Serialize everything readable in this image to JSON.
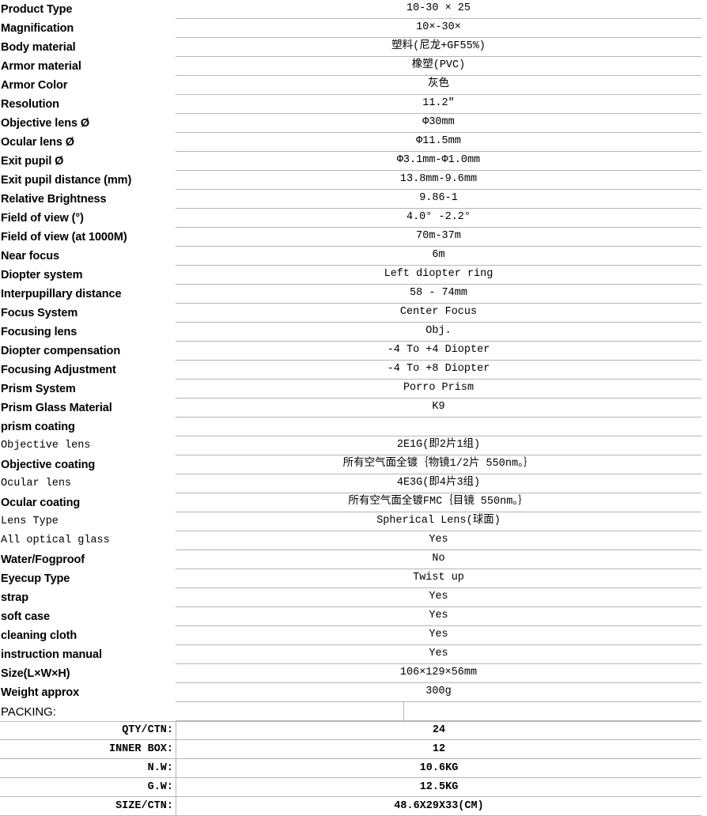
{
  "table": {
    "rows": [
      {
        "label": "Product Type",
        "label_style": "sans",
        "value": "10-30 × 25"
      },
      {
        "label": "Magnification",
        "label_style": "sans",
        "value": "10×-30×"
      },
      {
        "label": "Body  material",
        "label_style": "sans",
        "value": "塑料(尼龙+GF55%)"
      },
      {
        "label": "Armor material",
        "label_style": "sans",
        "value": "橡塑(PVC)"
      },
      {
        "label": "Armor Color",
        "label_style": "sans",
        "value": "灰色"
      },
      {
        "label": "Resolution",
        "label_style": "sans",
        "value": "11.2″"
      },
      {
        "label": " Objective lens Ø",
        "label_style": "sans",
        "value": "Φ30mm"
      },
      {
        "label": "Ocular lens Ø",
        "label_style": "sans",
        "value": "Φ11.5mm"
      },
      {
        "label": "Exit pupil Ø",
        "label_style": "sans",
        "value": "Φ3.1mm-Φ1.0mm"
      },
      {
        "label": "Exit pupil distance (mm)",
        "label_style": "sans",
        "value": "13.8mm-9.6mm"
      },
      {
        "label": "Relative Brightness",
        "label_style": "sans",
        "value": "9.86-1"
      },
      {
        "label": "Field of view (°)",
        "label_style": "sans",
        "value": "4.0° -2.2°"
      },
      {
        "label": "Field of view (at 1000M)",
        "label_style": "sans",
        "value": "70m-37m"
      },
      {
        "label": "Near focus",
        "label_style": "sans",
        "value": "6m"
      },
      {
        "label": "Diopter system",
        "label_style": "sans",
        "value": "Left diopter ring"
      },
      {
        "label": " Interpupillary distance",
        "label_style": "sans",
        "value": "58 - 74mm"
      },
      {
        "label": "Focus System",
        "label_style": "sans",
        "value": "Center Focus"
      },
      {
        "label": "Focusing lens",
        "label_style": "sans",
        "value": "Obj."
      },
      {
        "label": "Diopter compensation",
        "label_style": "sans",
        "value": "-4 To +4 Diopter"
      },
      {
        "label": "Focusing Adjustment",
        "label_style": "sans",
        "value": "-4 To +8 Diopter"
      },
      {
        "label": "Prism System",
        "label_style": "sans",
        "value": "Porro Prism"
      },
      {
        "label": "Prism Glass Material",
        "label_style": "sans",
        "value": "K9"
      },
      {
        "label": "prism coating",
        "label_style": "sans",
        "value": ""
      },
      {
        "label": "Objective lens",
        "label_style": "mono",
        "value": "2E1G(即2片1组)"
      },
      {
        "label": "Objective coating",
        "label_style": "sans",
        "value": "所有空气面全镀｛物镜1/2片 550nm。｝"
      },
      {
        "label": "Ocular lens",
        "label_style": "mono",
        "value": "4E3G(即4片3组)"
      },
      {
        "label": "Ocular coating",
        "label_style": "sans",
        "value": "所有空气面全镀FMC｛目镜 550nm。｝"
      },
      {
        "label": " Lens Type",
        "label_style": "mono",
        "value": "Spherical Lens(球面)"
      },
      {
        "label": "All optical glass",
        "label_style": "mono",
        "value": "Yes"
      },
      {
        "label": "Water/Fogproof",
        "label_style": "sans",
        "value": "No"
      },
      {
        "label": "Eyecup Type",
        "label_style": "sans",
        "value": "Twist up"
      },
      {
        "label": "strap",
        "label_style": "sans",
        "value": "Yes"
      },
      {
        "label": "soft case",
        "label_style": "sans",
        "value": "Yes"
      },
      {
        "label": "cleaning cloth",
        "label_style": "sans",
        "value": "Yes"
      },
      {
        "label": "instruction manual",
        "label_style": "sans",
        "value": "Yes"
      },
      {
        "label": "Size(L×W×H)",
        "label_style": "sans",
        "value": "106×129×56mm"
      },
      {
        "label": "Weight approx",
        "label_style": "sans",
        "value": "300g"
      }
    ]
  },
  "packing": {
    "heading": "PACKING:",
    "rows": [
      {
        "label": "QTY/CTN:",
        "value": "24"
      },
      {
        "label": "INNER BOX:",
        "value": "12"
      },
      {
        "label": "N.W:",
        "value": "10.6KG"
      },
      {
        "label": "G.W:",
        "value": "12.5KG"
      },
      {
        "label": "SIZE/CTN:",
        "value": "48.6X29X33(CM)"
      }
    ]
  },
  "colors": {
    "rule": "#b7b7b7",
    "text": "#000000",
    "background": "#ffffff"
  }
}
